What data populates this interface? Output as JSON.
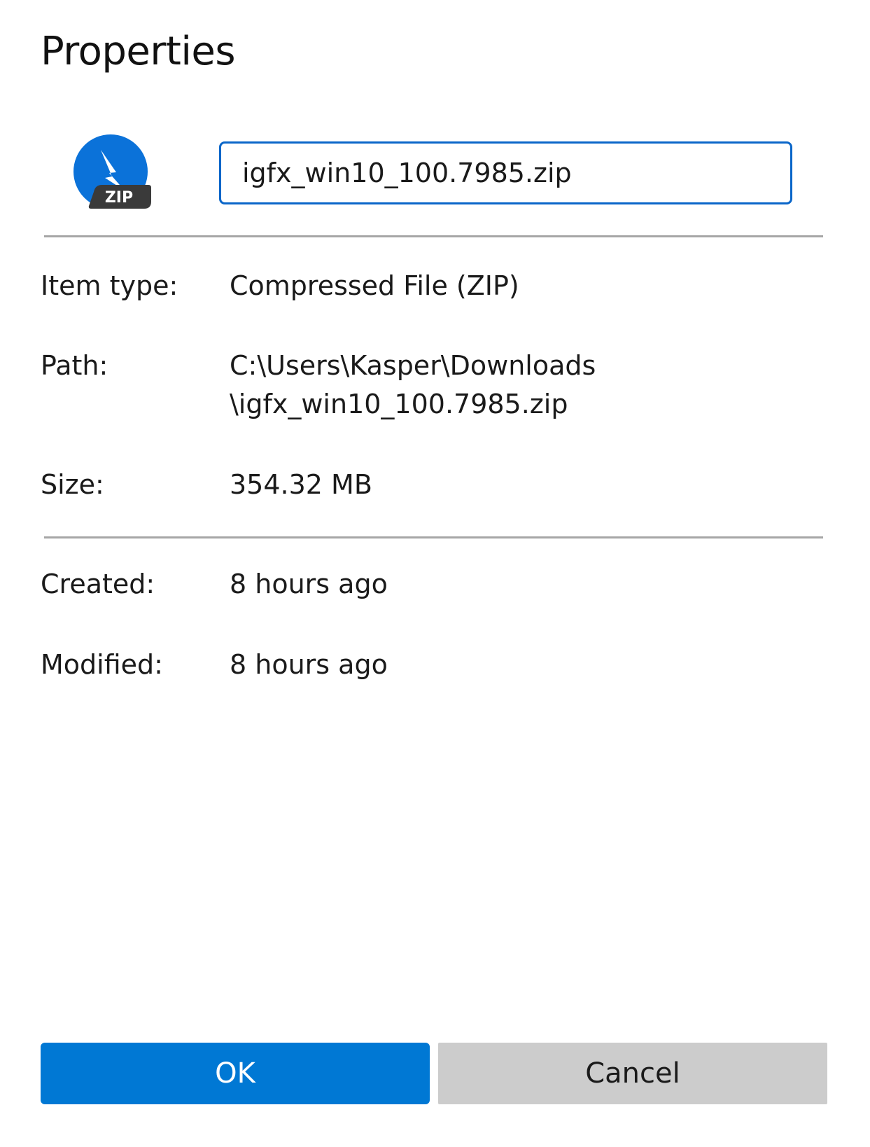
{
  "dialog": {
    "title": "Properties"
  },
  "file": {
    "icon": "zip-file-icon",
    "icon_badge": "ZIP",
    "name": "igfx_win10_100.7985.zip"
  },
  "properties": {
    "item_type": {
      "label": "Item type:",
      "value": "Compressed File (ZIP)"
    },
    "path": {
      "label": "Path:",
      "value_line1": "C:\\Users\\Kasper\\Downloads",
      "value_line2": "\\igfx_win10_100.7985.zip"
    },
    "size": {
      "label": "Size:",
      "value": "354.32 MB"
    },
    "created": {
      "label": "Created:",
      "value": "8 hours ago"
    },
    "modified": {
      "label": "Modified:",
      "value": "8 hours ago"
    }
  },
  "buttons": {
    "ok": "OK",
    "cancel": "Cancel"
  },
  "colors": {
    "accent": "#0078d4",
    "input_border": "#0a66c9",
    "icon_blue": "#0b72d9",
    "badge_dark": "#3a3a3a",
    "cancel_bg": "#cccccc",
    "divider": "#a6a6a6"
  }
}
